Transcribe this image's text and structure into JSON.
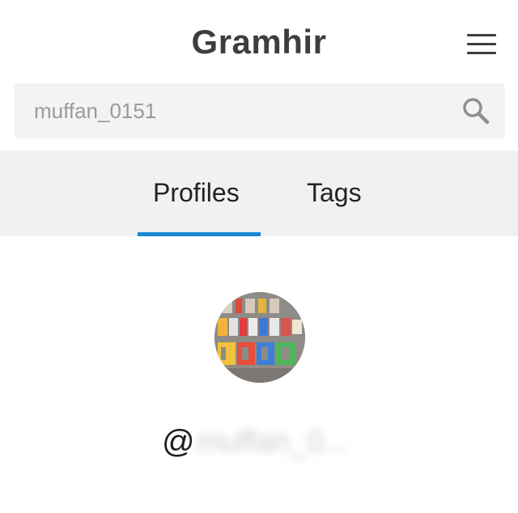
{
  "header": {
    "title": "Gramhir"
  },
  "search": {
    "value": "muffan_0151",
    "placeholder": ""
  },
  "tabs": [
    {
      "label": "Profiles",
      "active": true
    },
    {
      "label": "Tags",
      "active": false
    }
  ],
  "profile": {
    "at_symbol": "@",
    "username": "muffan_0..."
  },
  "colors": {
    "accent": "#1a88d8",
    "title_text": "#3d3d3d",
    "tab_bar_bg": "#f1f1f1",
    "search_bg": "#f3f3f3"
  },
  "icons": {
    "menu": "hamburger-menu-icon",
    "search": "magnifier-icon"
  }
}
